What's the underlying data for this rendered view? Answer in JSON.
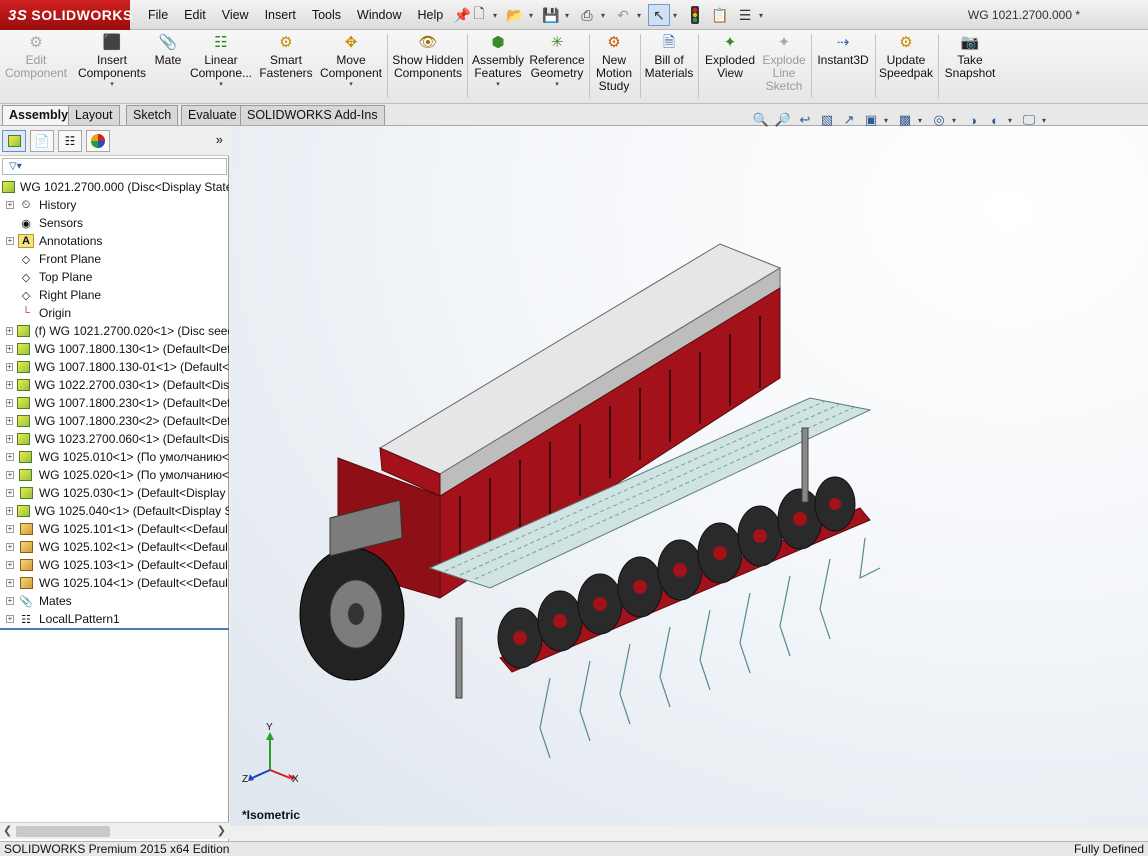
{
  "app": {
    "logo": "SOLIDWORKS",
    "logo_prefix": "3S",
    "document_title": "WG 1021.2700.000 *"
  },
  "menu": [
    "File",
    "Edit",
    "View",
    "Insert",
    "Tools",
    "Window",
    "Help"
  ],
  "command_manager": {
    "buttons": [
      {
        "label": "Edit Component",
        "icon": "edit-component-icon",
        "disabled": true
      },
      {
        "label": "Insert Components",
        "icon": "insert-components-icon"
      },
      {
        "label": "Mate",
        "icon": "mate-icon"
      },
      {
        "label": "Linear Compone...",
        "icon": "linear-pattern-icon"
      },
      {
        "label": "Smart Fasteners",
        "icon": "smart-fasteners-icon"
      },
      {
        "label": "Move Component",
        "icon": "move-component-icon"
      },
      {
        "label": "Show Hidden Components",
        "icon": "show-hidden-icon"
      },
      {
        "label": "Assembly Features",
        "icon": "assembly-features-icon"
      },
      {
        "label": "Reference Geometry",
        "icon": "reference-geometry-icon"
      },
      {
        "label": "New Motion Study",
        "icon": "motion-study-icon"
      },
      {
        "label": "Bill of Materials",
        "icon": "bom-icon"
      },
      {
        "label": "Exploded View",
        "icon": "exploded-view-icon"
      },
      {
        "label": "Explode Line Sketch",
        "icon": "explode-line-icon",
        "disabled": true
      },
      {
        "label": "Instant3D",
        "icon": "instant3d-icon"
      },
      {
        "label": "Update Speedpak",
        "icon": "speedpak-icon"
      },
      {
        "label": "Take Snapshot",
        "icon": "snapshot-icon"
      }
    ]
  },
  "tabs": [
    "Assembly",
    "Layout",
    "Sketch",
    "Evaluate",
    "SOLIDWORKS Add-Ins"
  ],
  "active_tab": "Assembly",
  "feature_tree": {
    "root": "WG 1021.2700.000  (Disc<Display State-",
    "items": [
      {
        "label": "History",
        "icon": "history-icon"
      },
      {
        "label": "Sensors",
        "icon": "sensor-icon"
      },
      {
        "label": "Annotations",
        "icon": "annotation-icon"
      },
      {
        "label": "Front Plane",
        "icon": "plane-icon"
      },
      {
        "label": "Top Plane",
        "icon": "plane-icon"
      },
      {
        "label": "Right Plane",
        "icon": "plane-icon"
      },
      {
        "label": "Origin",
        "icon": "origin-icon"
      },
      {
        "label": "(f) WG 1021.2700.020<1>  (Disc seed",
        "icon": "subassembly-icon"
      },
      {
        "label": "WG 1007.1800.130<1>  (Default<Def",
        "icon": "subassembly-icon"
      },
      {
        "label": "WG 1007.1800.130-01<1>  (Default<",
        "icon": "subassembly-icon"
      },
      {
        "label": "WG 1022.2700.030<1>  (Default<Dis",
        "icon": "subassembly-icon"
      },
      {
        "label": "WG 1007.1800.230<1>  (Default<Def",
        "icon": "subassembly-icon"
      },
      {
        "label": "WG 1007.1800.230<2>  (Default<Def",
        "icon": "subassembly-icon"
      },
      {
        "label": "WG 1023.2700.060<1>  (Default<Dis",
        "icon": "subassembly-icon"
      },
      {
        "label": "WG 1025.010<1>  (По умолчанию<",
        "icon": "subassembly-icon"
      },
      {
        "label": "WG 1025.020<1>  (По умолчанию<",
        "icon": "subassembly-icon"
      },
      {
        "label": "WG 1025.030<1>  (Default<Display",
        "icon": "subassembly-icon"
      },
      {
        "label": "WG 1025.040<1>  (Default<Display S",
        "icon": "subassembly-icon"
      },
      {
        "label": "WG 1025.101<1>  (Default<<Defaul",
        "icon": "part-icon"
      },
      {
        "label": "WG 1025.102<1>  (Default<<Defaul",
        "icon": "part-icon"
      },
      {
        "label": "WG 1025.103<1>  (Default<<Defaul",
        "icon": "part-icon"
      },
      {
        "label": "WG 1025.104<1>  (Default<<Defaul",
        "icon": "part-icon"
      },
      {
        "label": "Mates",
        "icon": "mates-icon"
      },
      {
        "label": "LocalLPattern1",
        "icon": "pattern-icon"
      }
    ]
  },
  "viewport": {
    "view_name": "*Isometric",
    "triad": {
      "x": "X",
      "y": "Y",
      "z": "Z"
    },
    "colors": {
      "body": "#a3121a",
      "hopper": "#cfcfcf",
      "wheel": "#2a2a2a",
      "platform": "#cfe3e3"
    }
  },
  "status": {
    "left": "SOLIDWORKS Premium 2015 x64 Edition",
    "right": "Fully Defined"
  }
}
